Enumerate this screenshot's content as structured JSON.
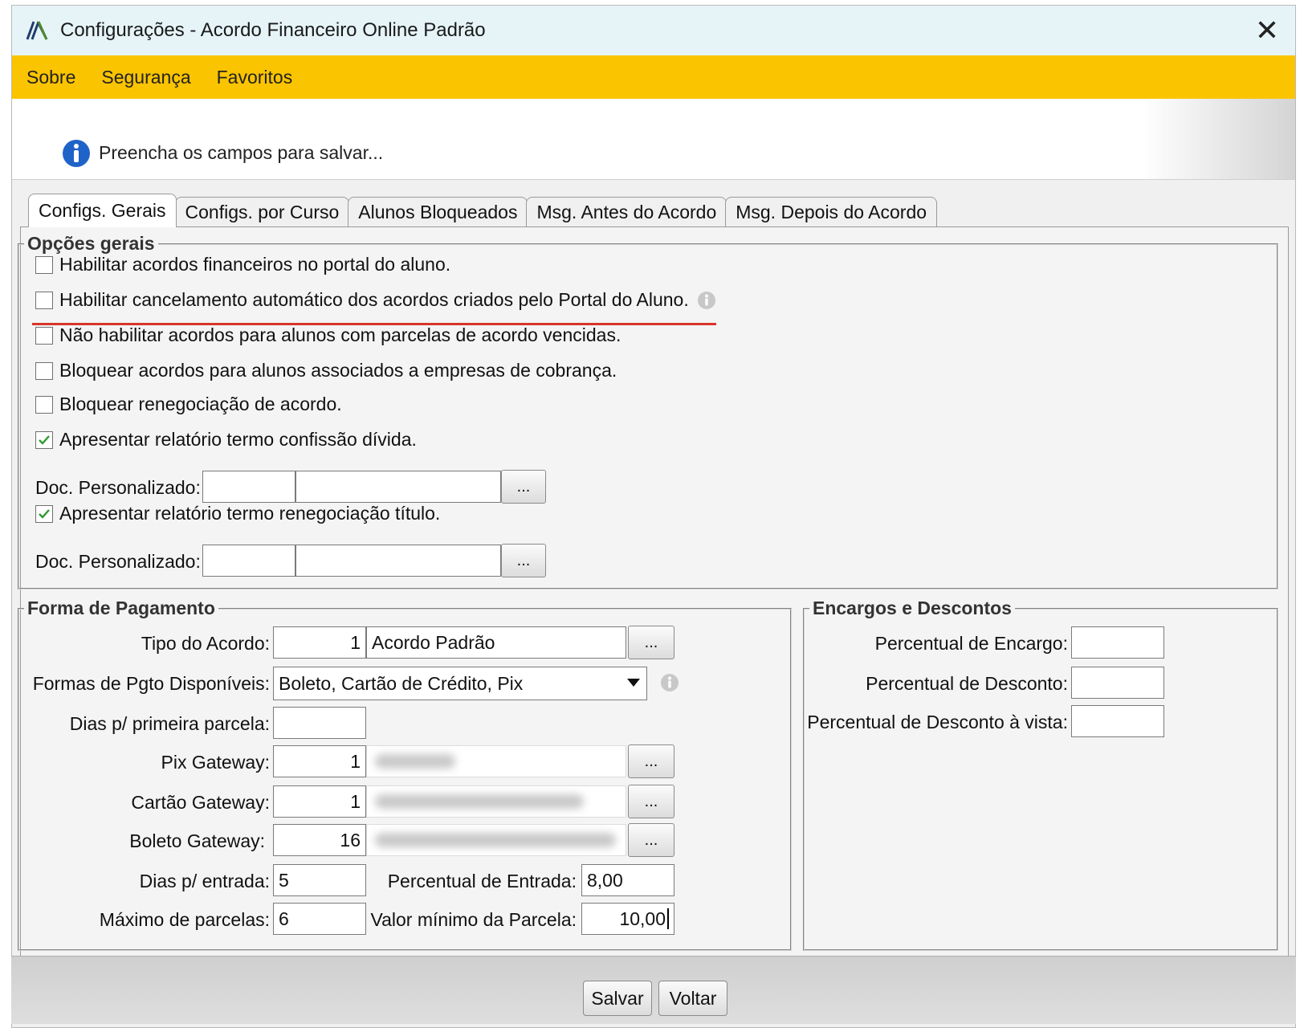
{
  "window": {
    "title": "Configurações - Acordo Financeiro Online Padrão"
  },
  "menu": {
    "items": [
      "Sobre",
      "Segurança",
      "Favoritos"
    ]
  },
  "info": {
    "message": "Preencha os campos para salvar..."
  },
  "tabs": [
    "Configs. Gerais",
    "Configs. por Curso",
    "Alunos Bloqueados",
    "Msg. Antes do Acordo",
    "Msg. Depois do Acordo"
  ],
  "opcoes": {
    "legend": "Opções gerais",
    "checks": [
      {
        "label": "Habilitar acordos financeiros no portal do aluno.",
        "checked": false
      },
      {
        "label": "Habilitar cancelamento automático dos acordos criados pelo Portal do Aluno.",
        "checked": false
      },
      {
        "label": "Não habilitar acordos para alunos com parcelas de acordo vencidas.",
        "checked": false
      },
      {
        "label": "Bloquear acordos para alunos associados a empresas de cobrança.",
        "checked": false
      },
      {
        "label": "Bloquear renegociação de acordo.",
        "checked": false
      },
      {
        "label": "Apresentar relatório termo confissão dívida.",
        "checked": true
      },
      {
        "label": "Apresentar relatório termo renegociação título.",
        "checked": true
      }
    ],
    "doc_label": "Doc. Personalizado:",
    "dots": "..."
  },
  "forma": {
    "legend": "Forma de Pagamento",
    "tipo_label": "Tipo do Acordo:",
    "tipo_code": "1",
    "tipo_name": "Acordo Padrão",
    "formas_label": "Formas de Pgto Disponíveis:",
    "formas_value": "Boleto, Cartão de Crédito, Pix",
    "dias_primeira_label": "Dias p/ primeira parcela:",
    "dias_primeira_value": "",
    "pix_label": "Pix Gateway:",
    "pix_code": "1",
    "cartao_label": "Cartão Gateway:",
    "cartao_code": "1",
    "boleto_label": "Boleto Gateway:",
    "boleto_code": "16",
    "dias_entrada_label": "Dias p/ entrada:",
    "dias_entrada_value": "5",
    "perc_entrada_label": "Percentual de Entrada:",
    "perc_entrada_value": "8,00",
    "max_parcelas_label": "Máximo de parcelas:",
    "max_parcelas_value": "6",
    "valor_min_label": "Valor mínimo da Parcela:",
    "valor_min_value": "10,00"
  },
  "encargos": {
    "legend": "Encargos e Descontos",
    "perc_encargo_label": "Percentual de Encargo:",
    "perc_desconto_label": "Percentual de Desconto:",
    "perc_desc_vista_label": "Percentual de Desconto à vista:"
  },
  "footer": {
    "save": "Salvar",
    "back": "Voltar"
  },
  "colors": {
    "menubar": "#fbc400",
    "titlebar": "#e6f4f8",
    "highlight_underline": "#d9342b"
  }
}
